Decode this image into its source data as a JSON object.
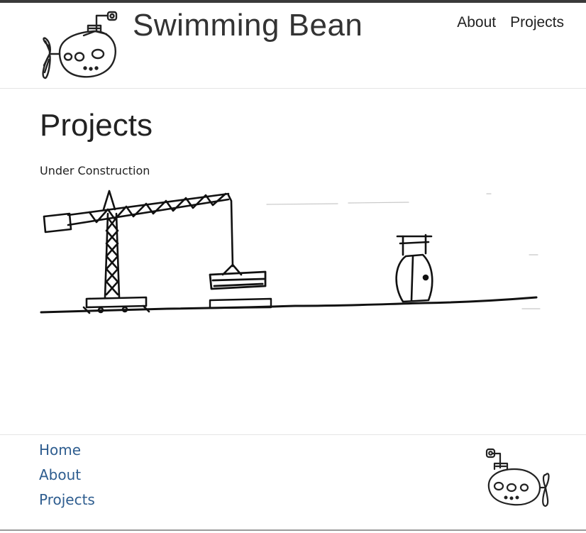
{
  "header": {
    "site_title": "Swimming Bean",
    "logo_icon": "submarine-icon",
    "nav": [
      {
        "label": "About"
      },
      {
        "label": "Projects"
      }
    ]
  },
  "main": {
    "page_title": "Projects",
    "status_text": "Under Construction",
    "illustration": "crane-and-ship-sketch"
  },
  "footer": {
    "links": [
      {
        "label": "Home"
      },
      {
        "label": "About"
      },
      {
        "label": "Projects"
      }
    ],
    "logo_icon": "submarine-icon",
    "link_color": "#2e5d8f"
  }
}
